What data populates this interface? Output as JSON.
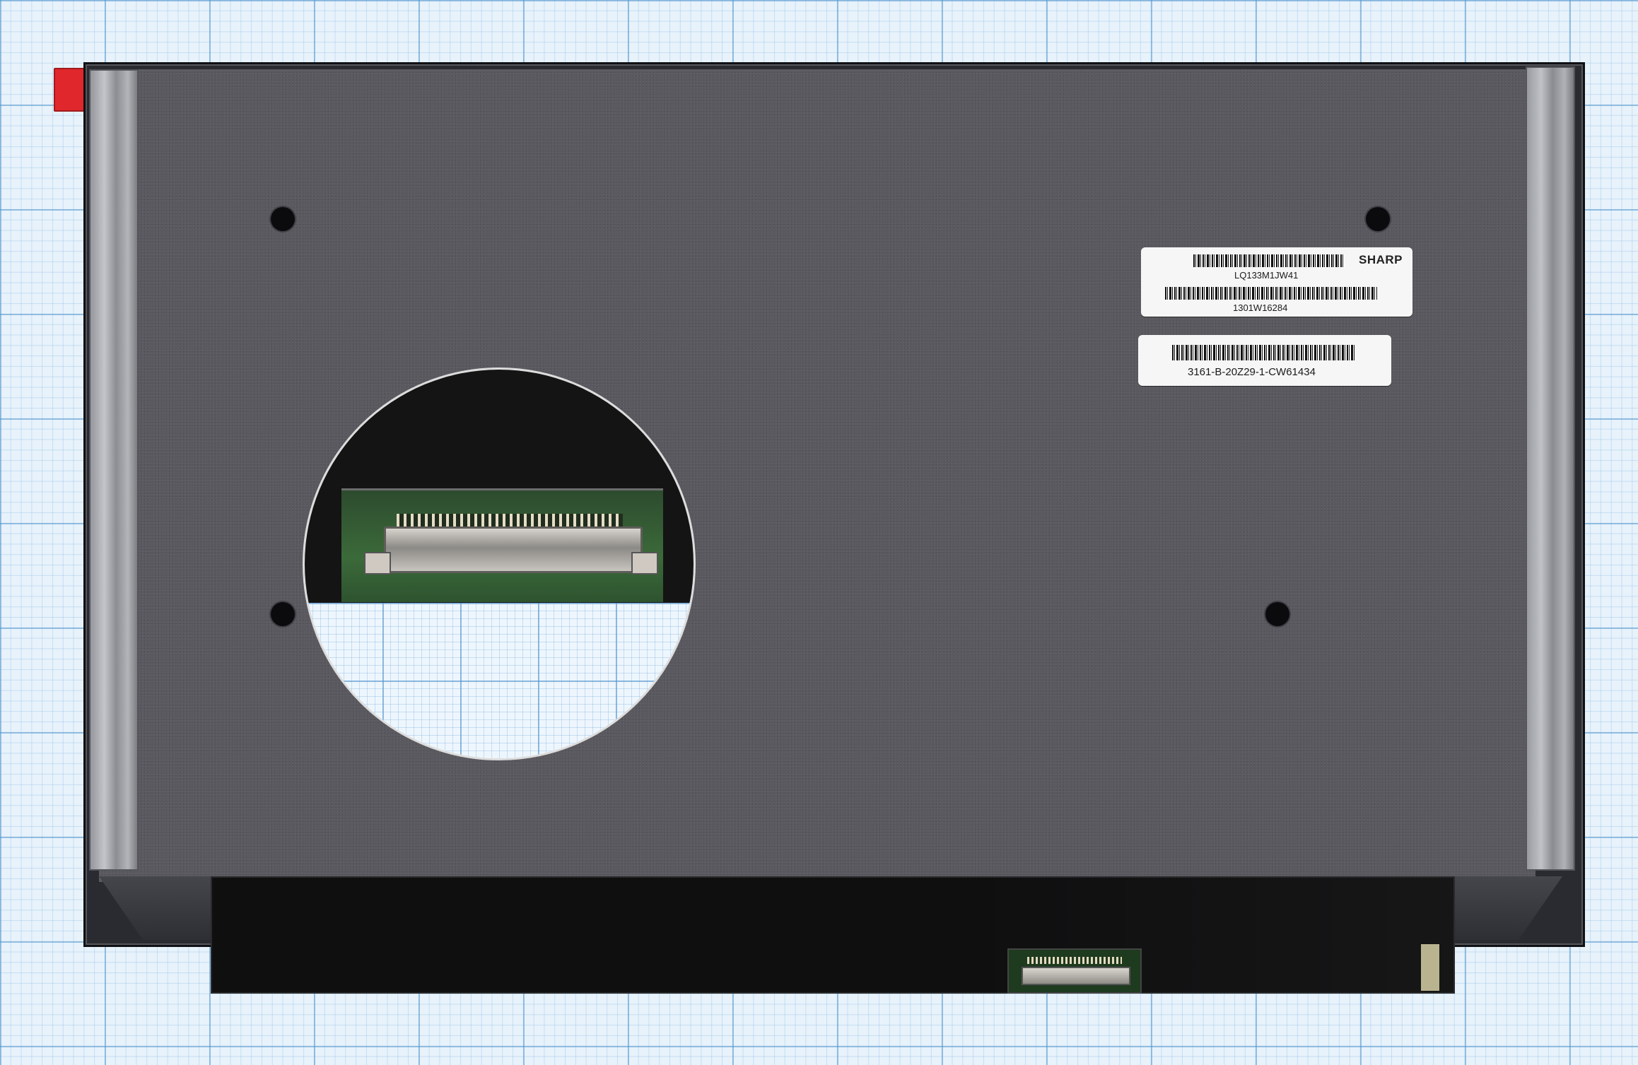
{
  "panel": {
    "brand": "SHARP",
    "model_label": "LQ133M1JW41",
    "serial_label": "1301W16284",
    "part_label": "3161-B-20Z29-1-CW61434"
  },
  "colors": {
    "grid_background": "#e7f2fb",
    "panel_plate": "#59595f",
    "pcb_green": "#3b6a3a",
    "tape_red": "#e0282c"
  },
  "icons": {
    "mounting_holes": "circle-hole-icon",
    "connector": "ribbon-connector-icon"
  }
}
